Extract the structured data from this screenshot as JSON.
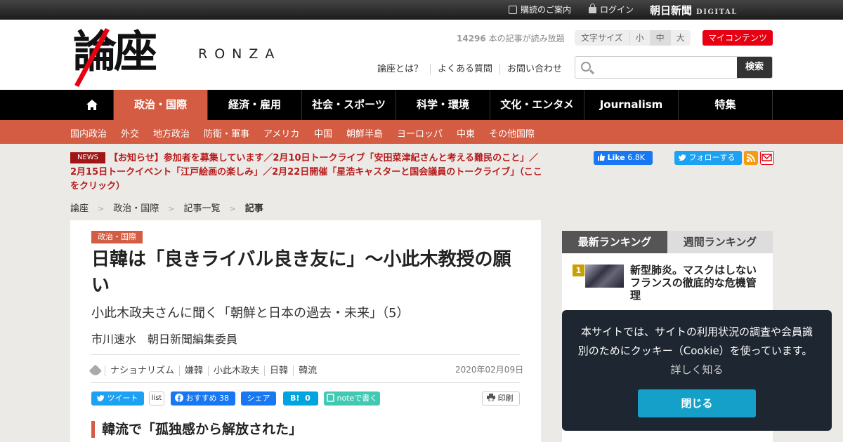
{
  "topbar": {
    "subscribe": "購読のご案内",
    "login": "ログイン",
    "brand": "朝日新聞",
    "brand_digital": "DIGITAL"
  },
  "header": {
    "logo_kanji": "論座",
    "logo_latin": "RONZA",
    "article_count": "14296",
    "article_count_suffix": " 本の記事が読み放題",
    "font_size_label": "文字サイズ",
    "font_sizes": [
      "小",
      "中",
      "大"
    ],
    "font_size_selected": "中",
    "my_content": "マイコンテンツ",
    "links": [
      "論座とは？",
      "よくある質問",
      "お問い合わせ"
    ],
    "search_placeholder": "",
    "search_button": "検索"
  },
  "nav": {
    "items": [
      "政治・国際",
      "経済・雇用",
      "社会・スポーツ",
      "科学・環境",
      "文化・エンタメ",
      "Journalism",
      "特集"
    ],
    "active": "政治・国際"
  },
  "subnav": [
    "国内政治",
    "外交",
    "地方政治",
    "防衛・軍事",
    "アメリカ",
    "中国",
    "朝鮮半島",
    "ヨーロッパ",
    "中東",
    "その他国際"
  ],
  "news": {
    "badge": "NEWS",
    "text": "【お知らせ】参加者を募集しています／2月10日トークライブ「安田菜津紀さんと考える難民のこと」／2月15日トークイベント「江戸絵画の楽しみ」／2月22日開催「星浩キャスターと国会議員のトークライブ」（ここをクリック）"
  },
  "social_top": {
    "fb_like": "Like",
    "fb_count": "6.8K",
    "twitter_follow": "フォローする"
  },
  "breadcrumb": [
    "論座",
    "政治・国際",
    "記事一覧",
    "記事"
  ],
  "article": {
    "category": "政治・国際",
    "title": "日韓は「良きライバル良き友に」～小此木教授の願い",
    "subtitle": "小此木政夫さんに聞く「朝鮮と日本の過去・未来」（5）",
    "author": "市川速水　朝日新聞編集委員",
    "tags": [
      "ナショナリズム",
      "嫌韓",
      "小此木政夫",
      "日韓",
      "韓流"
    ],
    "date": "2020年02月09日",
    "share": {
      "tweet": "ツイート",
      "list": "list",
      "fb_recommend": "おすすめ",
      "fb_count": "38",
      "fb_share": "シェア",
      "hatena": "B!",
      "hatena_count": "0",
      "note": "noteで書く",
      "print": "印刷"
    },
    "section_heading": "韓流で「孤独感から解放された」"
  },
  "ranking": {
    "tabs": [
      "最新ランキング",
      "週間ランキング"
    ],
    "items": [
      {
        "rank": "1",
        "title": "新型肺炎。マスクはしないフランスの徹底的な危機管理"
      }
    ]
  },
  "cookie": {
    "message": "本サイトでは、サイトの利用状況の調査や会員識別のためにクッキー（Cookie）を使っています。",
    "more": "詳しく知る",
    "close": "閉じる"
  },
  "colors": {
    "accent": "#d35c42",
    "news_red": "#b71c1c",
    "my_content_red": "#e60012",
    "cookie_bg": "#1e2631",
    "cookie_button": "#14a0c8"
  }
}
